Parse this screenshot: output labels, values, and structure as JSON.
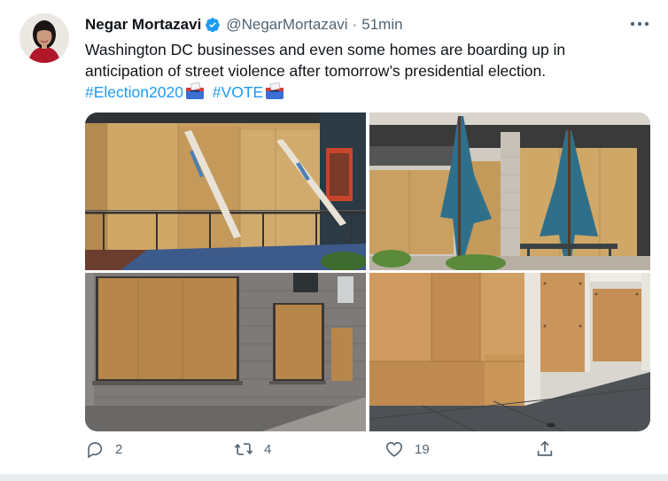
{
  "tweet": {
    "author_name": "Negar Mortazavi",
    "handle": "@NegarMortazavi",
    "separator": "·",
    "time": "51min",
    "text_line1": "Washington DC businesses and even some homes are boarding up in",
    "text_line2": "anticipation of street violence after tomorrow’s presidential election.",
    "hashtag1": "#Election2020",
    "hashtag2": "#VOTE",
    "photos": [
      {
        "icon": "photo-boarded-storefront-with-planks"
      },
      {
        "icon": "photo-patio-umbrellas-plywood"
      },
      {
        "icon": "photo-brick-building-boarded-windows"
      },
      {
        "icon": "photo-plywood-walls-sidewalk"
      }
    ]
  },
  "actions": {
    "reply_count": "2",
    "retweet_count": "4",
    "like_count": "19"
  },
  "colors": {
    "link": "#1d9bf0",
    "verified": "#1d9bf0",
    "secondary_text": "#536471",
    "plywood": "#c9a062"
  },
  "icons": {
    "verified": "verified-badge-icon",
    "more": "more-options-icon",
    "reply": "reply-icon",
    "retweet": "retweet-icon",
    "like": "heart-icon",
    "share": "share-icon",
    "ballot": "ballot-box-emoji"
  }
}
